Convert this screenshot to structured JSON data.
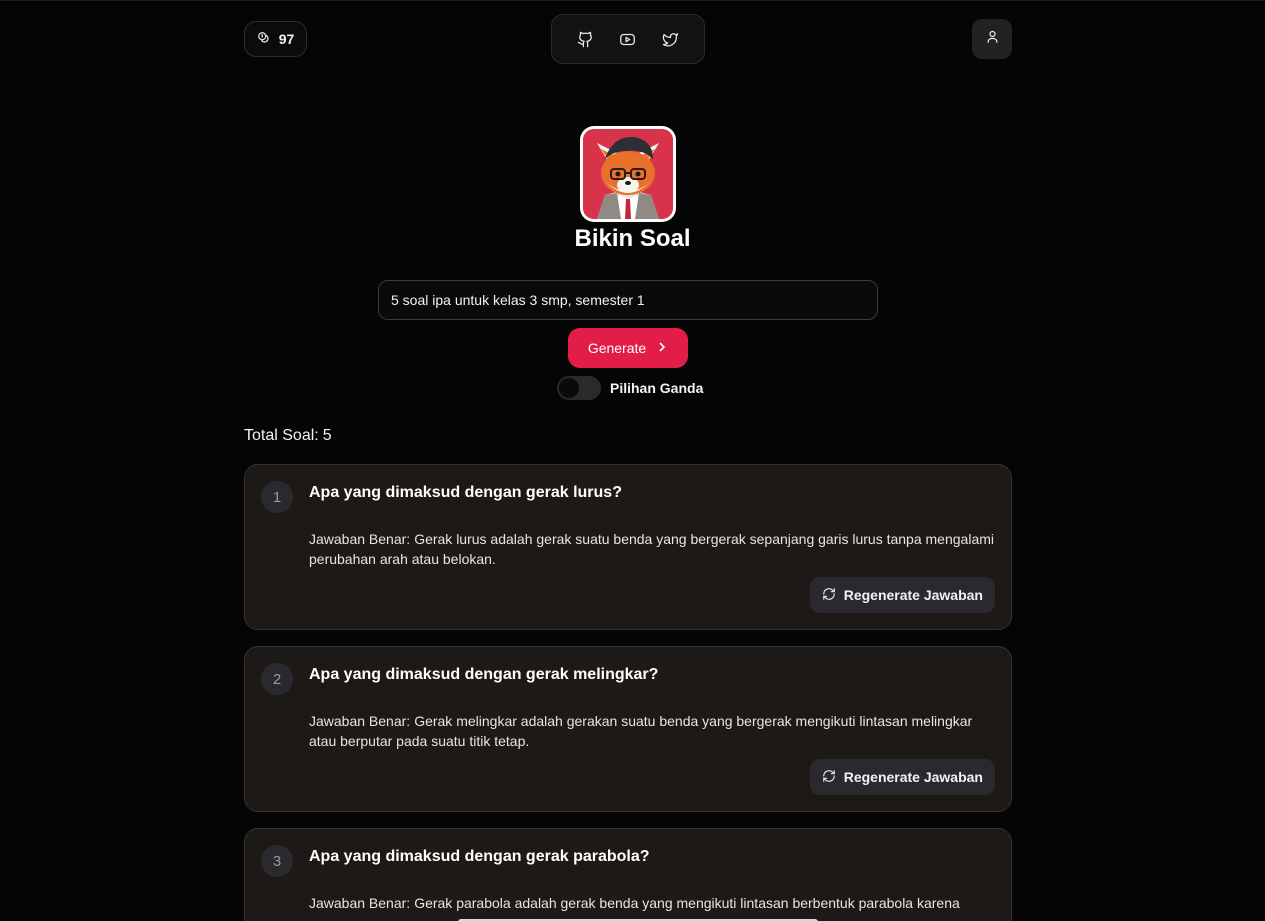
{
  "header": {
    "credits": "97",
    "social": [
      "github-icon",
      "youtube-icon",
      "twitter-icon"
    ],
    "user": "user-icon"
  },
  "app": {
    "title": "Bikin Soal"
  },
  "form": {
    "prompt_value": "5 soal ipa untuk kelas 3 smp, semester 1",
    "generate_label": "Generate",
    "toggle_label": "Pilihan Ganda",
    "toggle_on": false
  },
  "results": {
    "total_label": "Total Soal:",
    "total_count": "5",
    "answer_prefix": "Jawaban Benar:",
    "regen_label": "Regenerate Jawaban",
    "items": [
      {
        "number": "1",
        "question": "Apa yang dimaksud dengan gerak lurus?",
        "answer": "Gerak lurus adalah gerak suatu benda yang bergerak sepanjang garis lurus tanpa mengalami perubahan arah atau belokan."
      },
      {
        "number": "2",
        "question": "Apa yang dimaksud dengan gerak melingkar?",
        "answer": "Gerak melingkar adalah gerakan suatu benda yang bergerak mengikuti lintasan melingkar atau berputar pada suatu titik tetap."
      },
      {
        "number": "3",
        "question": "Apa yang dimaksud dengan gerak parabola?",
        "answer": "Gerak parabola adalah gerak benda yang mengikuti lintasan berbentuk parabola karena"
      }
    ]
  },
  "colors": {
    "accent": "#e21d48",
    "background": "#050505",
    "card": "#1c1917"
  }
}
